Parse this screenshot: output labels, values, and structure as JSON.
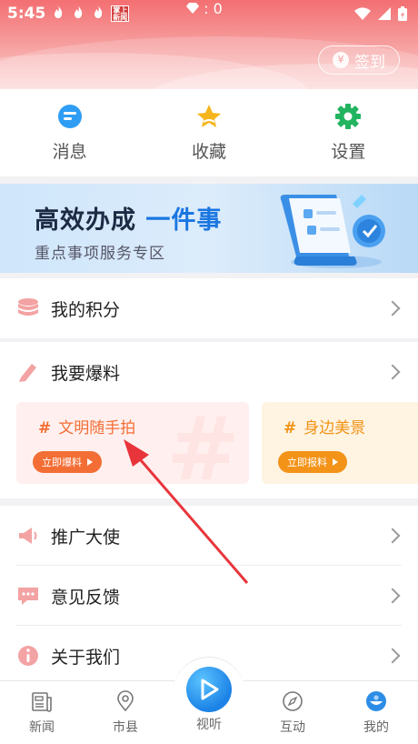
{
  "status_bar": {
    "time": "5:45",
    "notif_icons": [
      "flame-icon",
      "flame-icon",
      "flame-icon"
    ],
    "badge_text": "掌上\n新闻",
    "center_text": ": 0"
  },
  "header": {
    "signin_label": "签到"
  },
  "quick_actions": [
    {
      "label": "消息",
      "icon": "message-icon",
      "color": "#2f9df4"
    },
    {
      "label": "收藏",
      "icon": "star-icon",
      "color": "#f5b51c"
    },
    {
      "label": "设置",
      "icon": "gear-icon",
      "color": "#22b45f"
    }
  ],
  "banner": {
    "title_main": "高效办成",
    "title_accent": "一件事",
    "subtitle": "重点事项服务专区"
  },
  "menu": {
    "points": "我的积分",
    "report": "我要爆料",
    "ambassador": "推广大使",
    "feedback": "意见反馈",
    "about": "关于我们"
  },
  "report_cards": [
    {
      "title": "文明随手拍",
      "button": "立即爆料",
      "color": "#f36e35",
      "bg": "#fff0ef"
    },
    {
      "title": "身边美景",
      "button": "立即报料",
      "color": "#f39318",
      "bg": "#fff4e2"
    }
  ],
  "bottom_nav": [
    {
      "label": "新闻",
      "icon": "newspaper-icon"
    },
    {
      "label": "市县",
      "icon": "location-pin-icon"
    },
    {
      "label": "视听",
      "icon": "play-icon"
    },
    {
      "label": "互动",
      "icon": "compass-icon"
    },
    {
      "label": "我的",
      "icon": "profile-icon"
    }
  ],
  "colors": {
    "header_red": "#f36f72",
    "accent_blue": "#1a76e0",
    "arrow_red": "#e8343b"
  }
}
